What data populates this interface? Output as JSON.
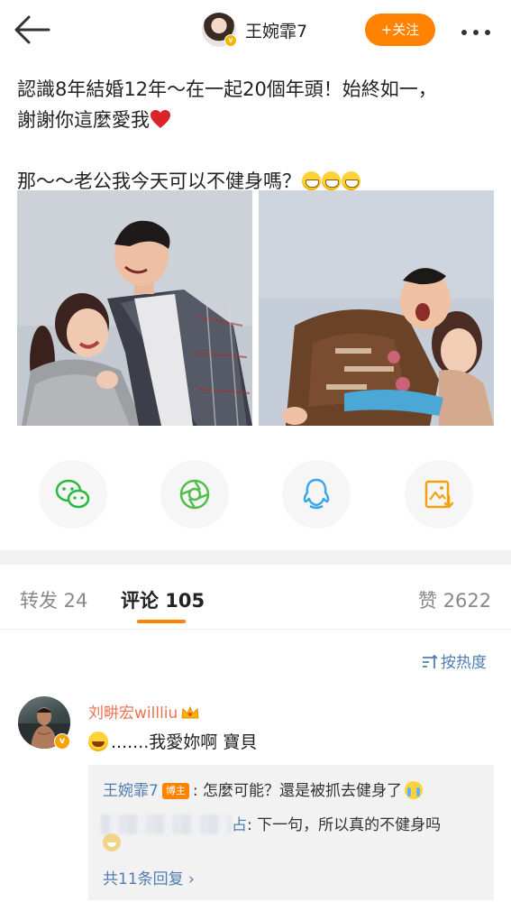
{
  "header": {
    "username": "王婉霏7",
    "follow_label": "+关注",
    "back_icon": "back-arrow-icon",
    "more_icon": "more-dots-icon"
  },
  "post": {
    "line1": "認識8年結婚12年～在一起20個年頭！始終如一，",
    "line2": "謝謝你這麼愛我",
    "line3": "那～～老公我今天可以不健身嗎？"
  },
  "share": [
    {
      "icon": "wechat-icon",
      "color": "#28b840"
    },
    {
      "icon": "moments-icon",
      "color": "#4fbf4a"
    },
    {
      "icon": "qq-icon",
      "color": "#3ca7e6"
    },
    {
      "icon": "save-image-icon",
      "color": "#f2a20f"
    }
  ],
  "tabs": {
    "repost": "转发 24",
    "comments": "评论 105",
    "likes": "赞 2622"
  },
  "sort_label": "按热度",
  "comment": {
    "author": "刘畊宏willliu",
    "text": ".......我愛妳啊 寶貝",
    "replies": [
      {
        "author": "王婉霏7",
        "tag": "博主",
        "text": ": 怎麼可能？還是被抓去健身了"
      },
      {
        "author_suffix": "占",
        "text": ": 下一句，所以真的不健身吗"
      }
    ],
    "more_replies": "共11条回复 ›"
  },
  "colors": {
    "accent": "#ff8200",
    "link": "#507daf",
    "name": "#eb7350"
  }
}
